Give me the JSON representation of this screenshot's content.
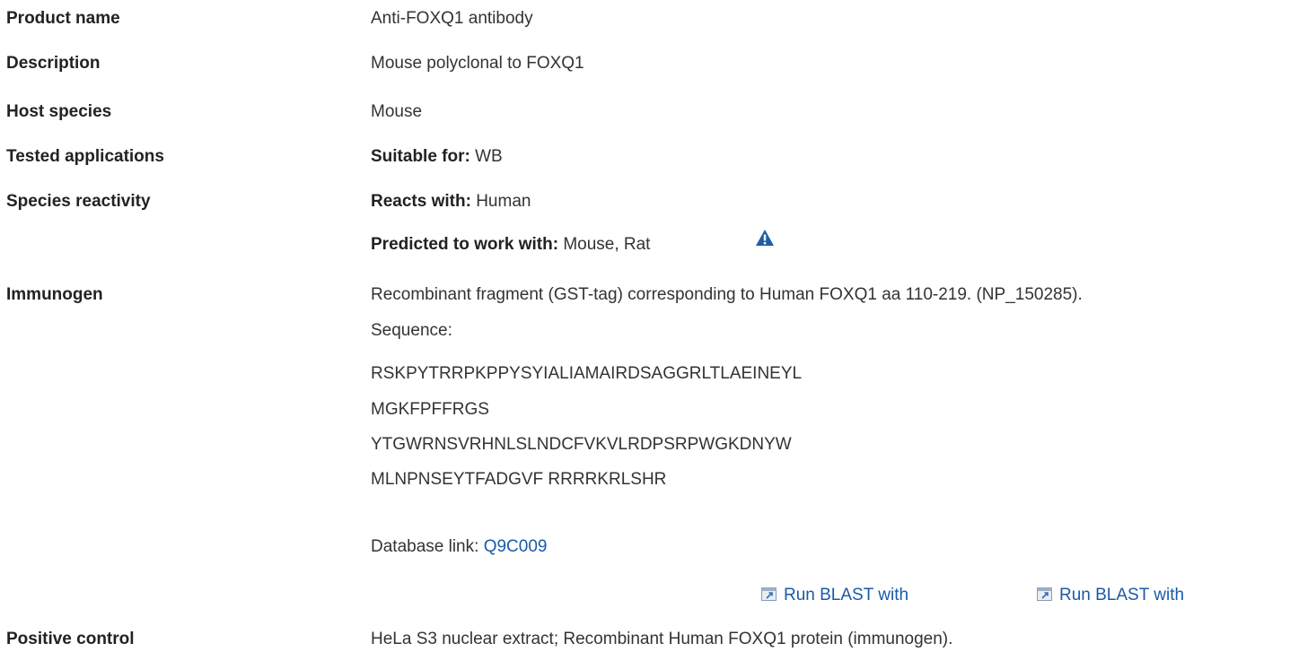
{
  "rows": {
    "product_name": {
      "label": "Product name",
      "value": "Anti-FOXQ1 antibody"
    },
    "description": {
      "label": "Description",
      "value": "Mouse polyclonal to FOXQ1"
    },
    "host_species": {
      "label": "Host species",
      "value": "Mouse"
    },
    "tested_applications": {
      "label": "Tested applications",
      "prefix": "Suitable for:",
      "value": "WB"
    },
    "species_reactivity": {
      "label": "Species reactivity",
      "reacts_prefix": "Reacts with:",
      "reacts_value": "Human",
      "predicted_prefix": "Predicted to work with:",
      "predicted_value": "Mouse, Rat"
    },
    "immunogen": {
      "label": "Immunogen",
      "text_line1": "Recombinant fragment (GST-tag) corresponding to Human FOXQ1 aa 110-219. (NP_150285).",
      "text_line2": "Sequence:",
      "sequence": [
        "RSKPYTRRPKPPYSYIALIAMAIRDSAGGRLTLAEINEYL",
        "MGKFPFFRGS",
        "YTGWRNSVRHNLSLNDCFVKVLRDPSRPWGKDNYW",
        "MLNPNSEYTFADGVF RRRRKRLSHR"
      ],
      "db_prefix": "Database link:",
      "db_link": "Q9C009",
      "blast_1": "Run BLAST with",
      "blast_2": "Run BLAST with"
    },
    "positive_control": {
      "label": "Positive control",
      "value": "HeLa S3 nuclear extract; Recombinant Human FOXQ1 protein (immunogen)."
    }
  },
  "icons": {
    "warning": "warning-icon",
    "external": "external-link-icon"
  },
  "colors": {
    "link": "#1a5aa8",
    "warning_icon": "#1f5fa5"
  }
}
